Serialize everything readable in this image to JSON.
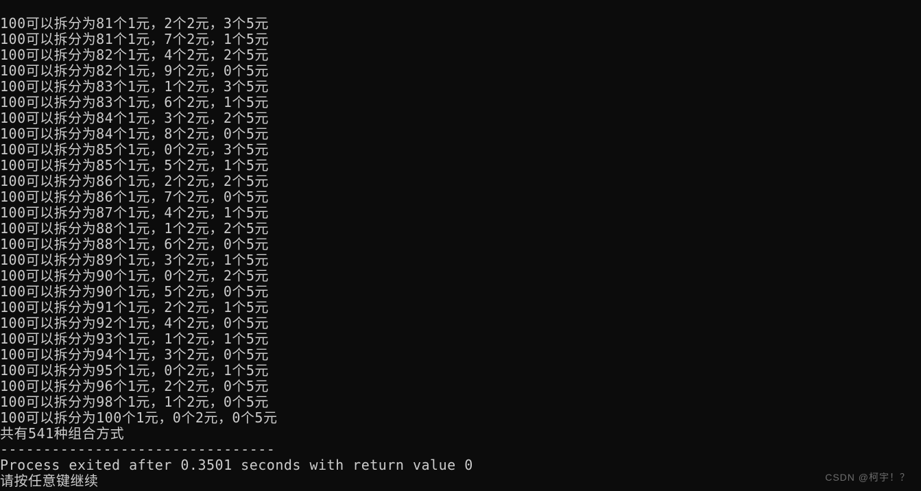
{
  "lines": [
    "100可以拆分为81个1元，2个2元，3个5元",
    "100可以拆分为81个1元，7个2元，1个5元",
    "100可以拆分为82个1元，4个2元，2个5元",
    "100可以拆分为82个1元，9个2元，0个5元",
    "100可以拆分为83个1元，1个2元，3个5元",
    "100可以拆分为83个1元，6个2元，1个5元",
    "100可以拆分为84个1元，3个2元，2个5元",
    "100可以拆分为84个1元，8个2元，0个5元",
    "100可以拆分为85个1元，0个2元，3个5元",
    "100可以拆分为85个1元，5个2元，1个5元",
    "100可以拆分为86个1元，2个2元，2个5元",
    "100可以拆分为86个1元，7个2元，0个5元",
    "100可以拆分为87个1元，4个2元，1个5元",
    "100可以拆分为88个1元，1个2元，2个5元",
    "100可以拆分为88个1元，6个2元，0个5元",
    "100可以拆分为89个1元，3个2元，1个5元",
    "100可以拆分为90个1元，0个2元，2个5元",
    "100可以拆分为90个1元，5个2元，0个5元",
    "100可以拆分为91个1元，2个2元，1个5元",
    "100可以拆分为92个1元，4个2元，0个5元",
    "100可以拆分为93个1元，1个2元，1个5元",
    "100可以拆分为94个1元，3个2元，0个5元",
    "100可以拆分为95个1元，0个2元，1个5元",
    "100可以拆分为96个1元，2个2元，0个5元",
    "100可以拆分为98个1元，1个2元，0个5元",
    "100可以拆分为100个1元，0个2元，0个5元"
  ],
  "summary": "共有541种组合方式",
  "separator": "--------------------------------",
  "exit_message": "Process exited after 0.3501 seconds with return value 0",
  "continue_prompt": "请按任意键继续",
  "watermark": "CSDN @柯宇！？"
}
